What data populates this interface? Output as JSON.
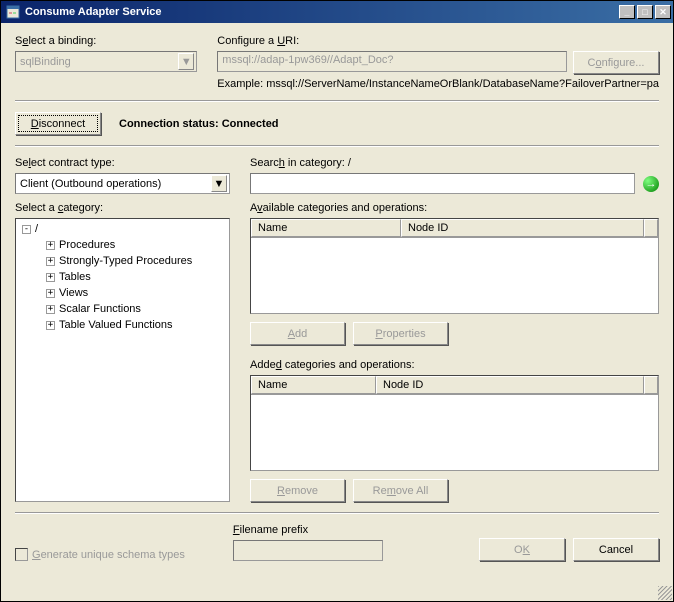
{
  "title": "Consume Adapter Service",
  "binding": {
    "label_pre": "S",
    "label_u": "e",
    "label_post": "lect a binding:",
    "value": "sqlBinding"
  },
  "uri": {
    "label_pre": "Configure a ",
    "label_u": "U",
    "label_post": "RI:",
    "value": "mssql://adap-1pw369//Adapt_Doc?",
    "configure_btn_pre": "C",
    "configure_btn_u": "o",
    "configure_btn_post": "nfigure...",
    "example": "Example: mssql://ServerName/InstanceNameOrBlank/DatabaseName?FailoverPartner=pa"
  },
  "connect": {
    "disconnect_pre": "",
    "disconnect_u": "D",
    "disconnect_post": "isconnect",
    "status_label": "Connection status:",
    "status_value": "Connected"
  },
  "contract": {
    "label_pre": "Se",
    "label_u": "l",
    "label_post": "ect contract type:",
    "value": "Client (Outbound operations)"
  },
  "search": {
    "label_pre": "Searc",
    "label_u": "h",
    "label_post": " in category: /"
  },
  "category": {
    "label_pre": "Select a ",
    "label_u": "c",
    "label_post": "ategory:",
    "root": "/",
    "items": [
      "Procedures",
      "Strongly-Typed Procedures",
      "Tables",
      "Views",
      "Scalar Functions",
      "Table Valued Functions"
    ]
  },
  "available": {
    "label_pre": "A",
    "label_u": "v",
    "label_post": "ailable categories and operations:",
    "col1": "Name",
    "col2": "Node ID",
    "add_pre": "",
    "add_u": "A",
    "add_post": "dd",
    "props_pre": "",
    "props_u": "P",
    "props_post": "roperties"
  },
  "added": {
    "label_pre": "Adde",
    "label_u": "d",
    "label_post": " categories and operations:",
    "col1": "Name",
    "col2": "Node ID",
    "remove_pre": "",
    "remove_u": "R",
    "remove_post": "emove",
    "removeall_pre": "Re",
    "removeall_u": "m",
    "removeall_post": "ove All"
  },
  "footer": {
    "gen_pre": "",
    "gen_u": "G",
    "gen_post": "enerate unique schema types",
    "prefix_pre": "",
    "prefix_u": "F",
    "prefix_post": "ilename prefix",
    "ok_pre": "O",
    "ok_u": "K",
    "ok_post": "",
    "cancel": "Cancel"
  }
}
